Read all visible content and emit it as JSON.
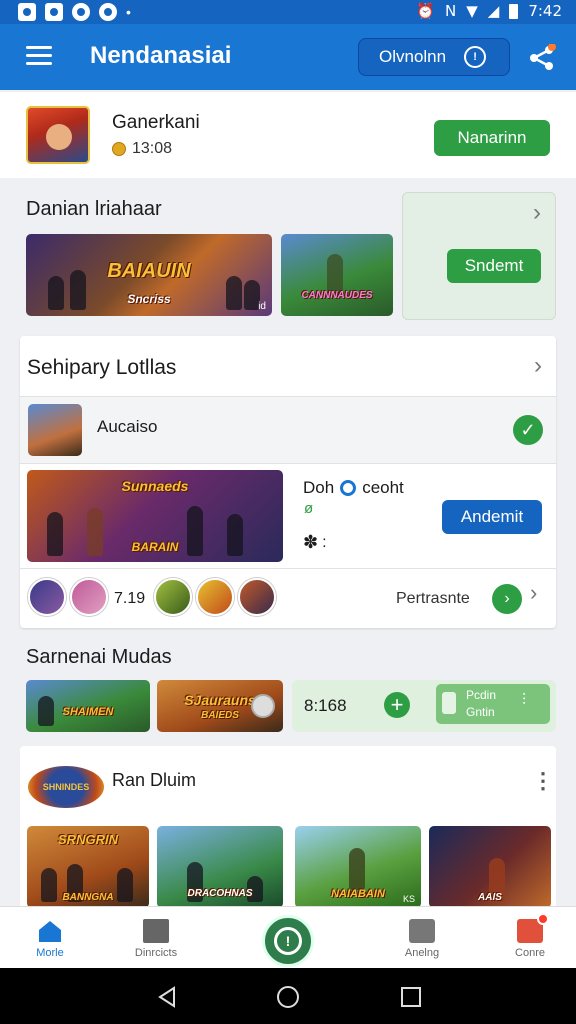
{
  "status": {
    "time": "7:42",
    "network": "N"
  },
  "appbar": {
    "title": "Nendanasiai",
    "button_label": "Olvnolnn"
  },
  "profile": {
    "name": "Ganerkani",
    "coins": "13:08",
    "action": "Nanarinn"
  },
  "featured": {
    "title": "Danian lriahaar",
    "thumb1_title": "BAIAUIN",
    "thumb1_sub": "Sncriss",
    "thumb1_tag": "id",
    "thumb2_title": "CANNNAUDES",
    "side_button": "Sndemt"
  },
  "section2": {
    "title": "Sehipary Lotllas",
    "item_label": "Aucaiso",
    "banner_title": "Sunnaeds",
    "banner_sub": "BARAIN",
    "info_line1": "Doh",
    "info_line2": "ceoht",
    "info_small": "ø",
    "info_dots": ":",
    "button": "Andemit",
    "avatar_count": "7.19",
    "footer_label": "Pertrasnte"
  },
  "section3": {
    "title": "Sarnenai Mudas",
    "thumb1_title": "SHAIMEN",
    "thumb2_title": "SJaurauns",
    "thumb2_sub": "BAIEDS",
    "counter": "8:168",
    "mini_line1": "Pcdin",
    "mini_line2": "Gntin"
  },
  "section4": {
    "title": "Ran Dluim",
    "logo_text": "SHNINDES",
    "thumbs": [
      "SRNGRIN",
      "DRACOHNAS",
      "NAIABAIN",
      "AAIS"
    ],
    "thumb1_sub": "BANNGNA",
    "thumb3_tag": "KS"
  },
  "nav": {
    "home": "Morle",
    "dirs": "Dinrcicts",
    "center": "",
    "acct": "Anelng",
    "core": "Conre"
  },
  "colors": {
    "primary": "#1976d2",
    "green": "#2e9e44",
    "blue_button": "#1565c0"
  }
}
